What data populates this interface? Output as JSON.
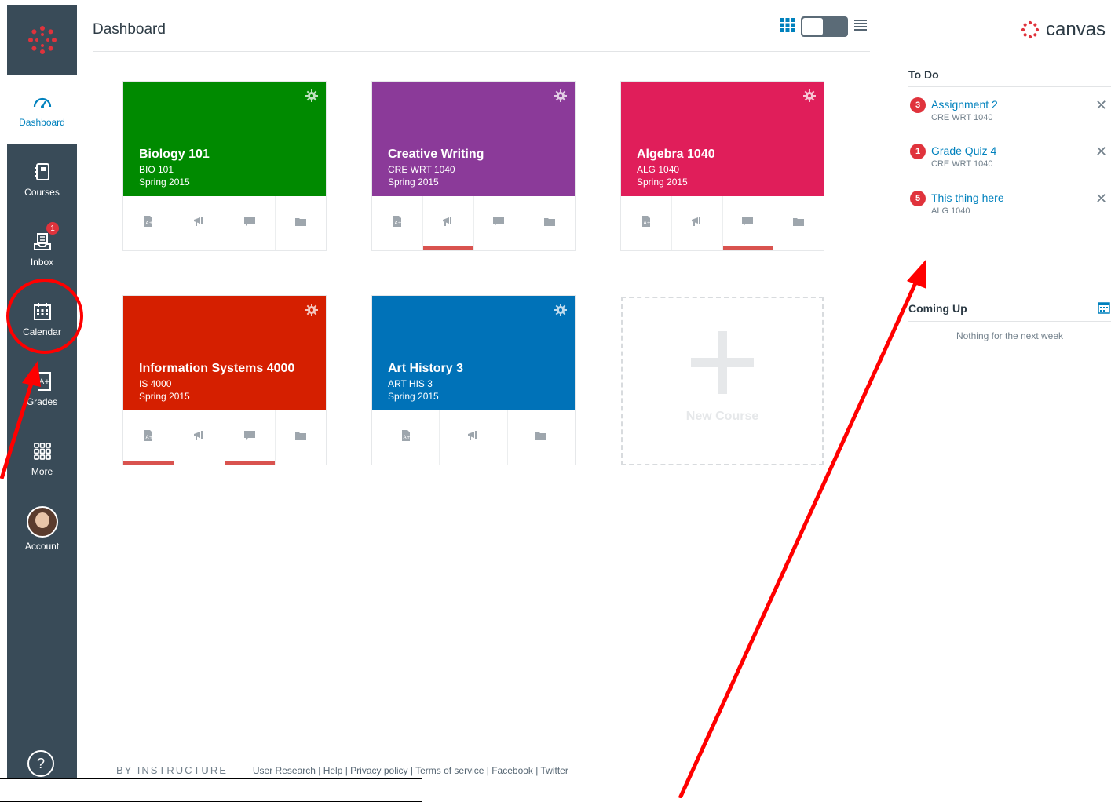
{
  "header": {
    "title": "Dashboard"
  },
  "nav": {
    "items": [
      {
        "label": "Dashboard"
      },
      {
        "label": "Courses"
      },
      {
        "label": "Inbox",
        "badge": "1"
      },
      {
        "label": "Calendar"
      },
      {
        "label": "Grades"
      },
      {
        "label": "More"
      },
      {
        "label": "Account"
      }
    ],
    "help": "?"
  },
  "cards": [
    {
      "title": "Biology 101",
      "code": "BIO 101",
      "term": "Spring 2015",
      "color": "#008a00"
    },
    {
      "title": "Creative Writing",
      "code": "CRE WRT 1040",
      "term": "Spring 2015",
      "color": "#8b3a99"
    },
    {
      "title": "Algebra 1040",
      "code": "ALG 1040",
      "term": "Spring 2015",
      "color": "#e01e5a"
    },
    {
      "title": "Information Systems 4000",
      "code": "IS 4000",
      "term": "Spring 2015",
      "color": "#d51f00"
    },
    {
      "title": "Art History 3",
      "code": "ART HIS 3",
      "term": "Spring 2015",
      "color": "#0072b8"
    }
  ],
  "new_course": {
    "label": "New Course"
  },
  "sidebar": {
    "brand": "canvas",
    "todo_heading": "To Do",
    "todos": [
      {
        "count": "3",
        "title": "Assignment 2",
        "course": "CRE WRT 1040"
      },
      {
        "count": "1",
        "title": "Grade Quiz 4",
        "course": "CRE WRT 1040"
      },
      {
        "count": "5",
        "title": "This thing here",
        "course": "ALG 1040"
      }
    ],
    "coming_heading": "Coming Up",
    "coming_empty": "Nothing for the next week"
  },
  "footer": {
    "brand": "BY INSTRUCTURE",
    "links": "User Research | Help | Privacy policy | Terms of service | Facebook | Twitter"
  },
  "colors": {
    "nav_bg": "#394b58",
    "link": "#0081bd",
    "badge": "#e0333c",
    "annotation": "#ff0000"
  }
}
